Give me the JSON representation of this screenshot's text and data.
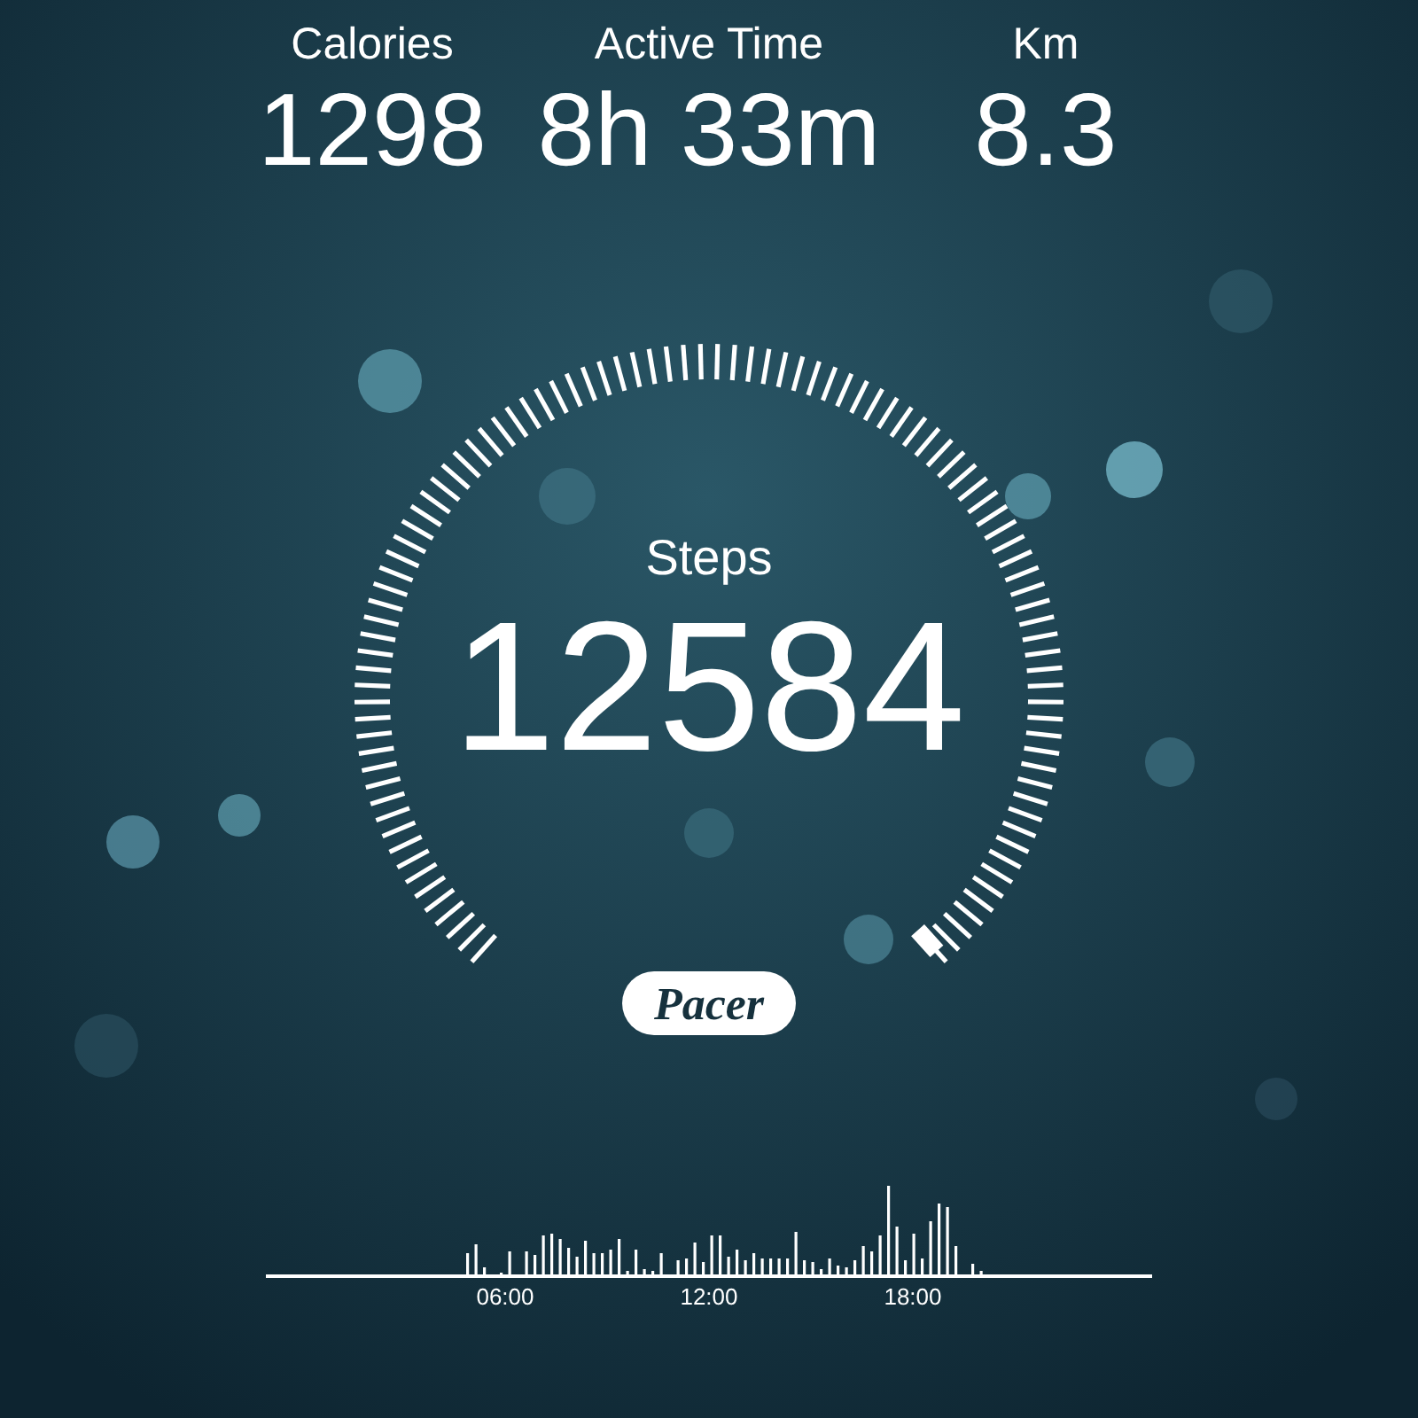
{
  "stats": [
    {
      "label": "Calories",
      "value": "1298"
    },
    {
      "label": "Active Time",
      "value": "8h 33m"
    },
    {
      "label": "Km",
      "value": "8.3"
    }
  ],
  "steps": {
    "label": "Steps",
    "value": "12584"
  },
  "logo": "Pacer",
  "activity": {
    "time_labels": [
      "06:00",
      "12:00",
      "18:00"
    ]
  }
}
